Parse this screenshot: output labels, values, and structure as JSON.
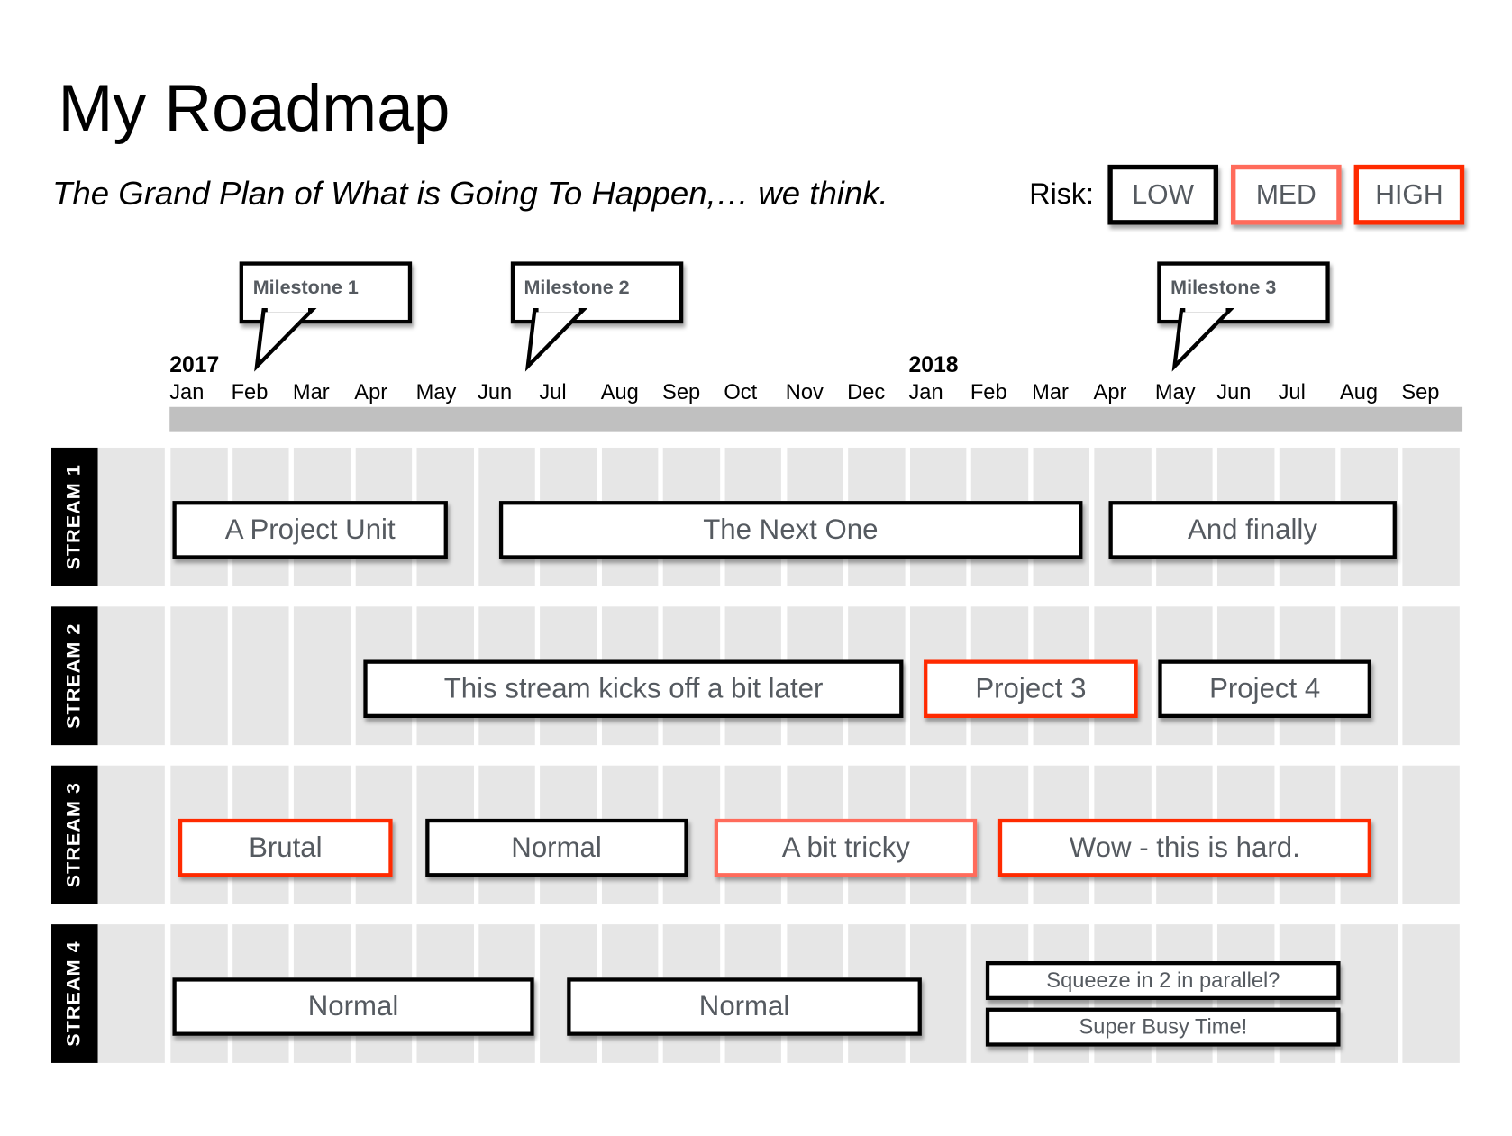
{
  "title": "My Roadmap",
  "subtitle": "The Grand Plan of What is Going To Happen,… we think.",
  "risk": {
    "label": "Risk:",
    "levels": [
      {
        "label": "LOW",
        "color": "#000000"
      },
      {
        "label": "MED",
        "color": "#ff6b5b"
      },
      {
        "label": "HIGH",
        "color": "#ff2a00"
      }
    ]
  },
  "timeline": {
    "years": [
      {
        "label": "2017",
        "month_index": 0
      },
      {
        "label": "2018",
        "month_index": 12
      }
    ],
    "months": [
      "Jan",
      "Feb",
      "Mar",
      "Apr",
      "May",
      "Jun",
      "Jul",
      "Aug",
      "Sep",
      "Oct",
      "Nov",
      "Dec",
      "Jan",
      "Feb",
      "Mar",
      "Apr",
      "May",
      "Jun",
      "Jul",
      "Aug",
      "Sep"
    ]
  },
  "milestones": [
    {
      "label": "Milestone 1",
      "month_index": 1.4
    },
    {
      "label": "Milestone 2",
      "month_index": 5.8
    },
    {
      "label": "Milestone 3",
      "month_index": 16.3
    }
  ],
  "streams": [
    {
      "label": "STREAM 1",
      "tasks": [
        {
          "label": "A Project Unit",
          "start": 0.0,
          "end": 4.5,
          "risk": "low"
        },
        {
          "label": "The Next One",
          "start": 5.3,
          "end": 14.8,
          "risk": "low"
        },
        {
          "label": "And finally",
          "start": 15.2,
          "end": 19.9,
          "risk": "low"
        }
      ]
    },
    {
      "label": "STREAM 2",
      "tasks": [
        {
          "label": "This stream kicks off a bit later",
          "start": 3.1,
          "end": 11.9,
          "risk": "low"
        },
        {
          "label": "Project 3",
          "start": 12.2,
          "end": 15.7,
          "risk": "high"
        },
        {
          "label": "Project 4",
          "start": 16.0,
          "end": 19.5,
          "risk": "low"
        }
      ]
    },
    {
      "label": "STREAM 3",
      "tasks": [
        {
          "label": "Brutal",
          "start": 0.1,
          "end": 3.6,
          "risk": "high"
        },
        {
          "label": "Normal",
          "start": 4.1,
          "end": 8.4,
          "risk": "low"
        },
        {
          "label": "A bit tricky",
          "start": 8.8,
          "end": 13.1,
          "risk": "med"
        },
        {
          "label": "Wow - this is hard.",
          "start": 13.4,
          "end": 19.5,
          "risk": "high"
        }
      ]
    },
    {
      "label": "STREAM 4",
      "tasks": [
        {
          "label": "Normal",
          "start": 0.0,
          "end": 5.9,
          "risk": "low"
        },
        {
          "label": "Normal",
          "start": 6.4,
          "end": 12.2,
          "risk": "low"
        },
        {
          "label": "Squeeze in 2 in parallel?",
          "start": 13.2,
          "end": 19.0,
          "risk": "low",
          "lane": "top"
        },
        {
          "label": "Super Busy Time!",
          "start": 13.2,
          "end": 19.0,
          "risk": "low",
          "lane": "bottom"
        }
      ]
    }
  ]
}
